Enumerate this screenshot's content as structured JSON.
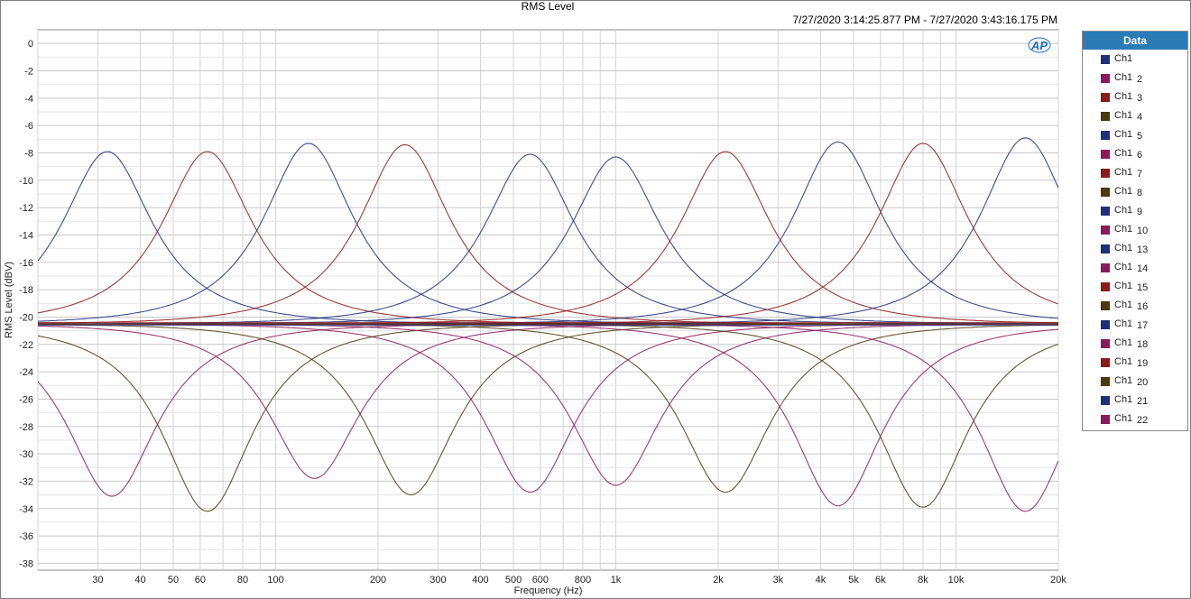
{
  "title": "RMS Level",
  "timestamp": "7/27/2020 3:14:25.877 PM - 7/27/2020 3:43:16.175 PM",
  "logo_text": "AP",
  "legend": {
    "header": "Data",
    "items": [
      {
        "name": "Ch1",
        "num": "",
        "color": "#1f2f7a"
      },
      {
        "name": "Ch1",
        "num": "2",
        "color": "#8b1a5a"
      },
      {
        "name": "Ch1",
        "num": "3",
        "color": "#8b1a1a"
      },
      {
        "name": "Ch1",
        "num": "4",
        "color": "#4a3a10"
      },
      {
        "name": "Ch1",
        "num": "5",
        "color": "#1f2f7a"
      },
      {
        "name": "Ch1",
        "num": "6",
        "color": "#8b1a5a"
      },
      {
        "name": "Ch1",
        "num": "7",
        "color": "#8b1a1a"
      },
      {
        "name": "Ch1",
        "num": "8",
        "color": "#4a3a10"
      },
      {
        "name": "Ch1",
        "num": "9",
        "color": "#1f2f7a"
      },
      {
        "name": "Ch1",
        "num": "10",
        "color": "#8b1a5a"
      },
      {
        "name": "Ch1",
        "num": "13",
        "color": "#1f2f7a"
      },
      {
        "name": "Ch1",
        "num": "14",
        "color": "#8b1a5a"
      },
      {
        "name": "Ch1",
        "num": "15",
        "color": "#8b1a1a"
      },
      {
        "name": "Ch1",
        "num": "16",
        "color": "#4a3a10"
      },
      {
        "name": "Ch1",
        "num": "17",
        "color": "#1f2f7a"
      },
      {
        "name": "Ch1",
        "num": "18",
        "color": "#8b1a5a"
      },
      {
        "name": "Ch1",
        "num": "19",
        "color": "#8b1a1a"
      },
      {
        "name": "Ch1",
        "num": "20",
        "color": "#4a3a10"
      },
      {
        "name": "Ch1",
        "num": "21",
        "color": "#1f2f7a"
      },
      {
        "name": "Ch1",
        "num": "22",
        "color": "#8b1a5a"
      }
    ]
  },
  "chart_data": {
    "type": "line",
    "title": "RMS Level",
    "xlabel": "Frequency (Hz)",
    "ylabel": "RMS Level (dBV)",
    "x_scale": "log",
    "xlim": [
      20,
      20000
    ],
    "ylim": [
      -38.5,
      1
    ],
    "grid": true,
    "legend_position": "right",
    "y_ticks": [
      0,
      -2,
      -4,
      -6,
      -8,
      -10,
      -12,
      -14,
      -16,
      -18,
      -20,
      -22,
      -24,
      -26,
      -28,
      -30,
      -32,
      -34,
      -36,
      -38
    ],
    "x_ticks": [
      {
        "v": 30,
        "label": "30"
      },
      {
        "v": 40,
        "label": "40"
      },
      {
        "v": 50,
        "label": "50"
      },
      {
        "v": 60,
        "label": "60"
      },
      {
        "v": 80,
        "label": "80"
      },
      {
        "v": 100,
        "label": "100"
      },
      {
        "v": 200,
        "label": "200"
      },
      {
        "v": 300,
        "label": "300"
      },
      {
        "v": 400,
        "label": "400"
      },
      {
        "v": 500,
        "label": "500"
      },
      {
        "v": 600,
        "label": "600"
      },
      {
        "v": 800,
        "label": "800"
      },
      {
        "v": 1000,
        "label": "1k"
      },
      {
        "v": 2000,
        "label": "2k"
      },
      {
        "v": 3000,
        "label": "3k"
      },
      {
        "v": 4000,
        "label": "4k"
      },
      {
        "v": 5000,
        "label": "5k"
      },
      {
        "v": 6000,
        "label": "6k"
      },
      {
        "v": 8000,
        "label": "8k"
      },
      {
        "v": 10000,
        "label": "10k"
      },
      {
        "v": 20000,
        "label": "20k"
      }
    ],
    "baseline_db": -20.5,
    "series": [
      {
        "center_hz": 32,
        "peak_db": -7.9,
        "color": "#1f2f7a"
      },
      {
        "center_hz": 63,
        "peak_db": -7.9,
        "color": "#8b1a1a"
      },
      {
        "center_hz": 125,
        "peak_db": -7.3,
        "color": "#1f2f7a"
      },
      {
        "center_hz": 240,
        "peak_db": -7.4,
        "color": "#8b1a1a"
      },
      {
        "center_hz": 560,
        "peak_db": -8.1,
        "color": "#1f2f7a"
      },
      {
        "center_hz": 1000,
        "peak_db": -8.3,
        "color": "#1f2f7a"
      },
      {
        "center_hz": 2100,
        "peak_db": -7.9,
        "color": "#8b1a1a"
      },
      {
        "center_hz": 4500,
        "peak_db": -7.2,
        "color": "#1f2f7a"
      },
      {
        "center_hz": 8000,
        "peak_db": -7.3,
        "color": "#8b1a1a"
      },
      {
        "center_hz": 16000,
        "peak_db": -6.9,
        "color": "#1f2f7a"
      },
      {
        "center_hz": 33,
        "peak_db": -33.1,
        "color": "#8b1a5a"
      },
      {
        "center_hz": 63,
        "peak_db": -34.2,
        "color": "#4a3a10"
      },
      {
        "center_hz": 130,
        "peak_db": -31.8,
        "color": "#8b1a5a"
      },
      {
        "center_hz": 250,
        "peak_db": -33.0,
        "color": "#4a3a10"
      },
      {
        "center_hz": 560,
        "peak_db": -32.8,
        "color": "#8b1a5a"
      },
      {
        "center_hz": 1000,
        "peak_db": -32.3,
        "color": "#8b1a5a"
      },
      {
        "center_hz": 2100,
        "peak_db": -32.8,
        "color": "#4a3a10"
      },
      {
        "center_hz": 4500,
        "peak_db": -33.8,
        "color": "#8b1a5a"
      },
      {
        "center_hz": 8000,
        "peak_db": -33.9,
        "color": "#4a3a10"
      },
      {
        "center_hz": 16000,
        "peak_db": -34.2,
        "color": "#8b1a5a"
      }
    ]
  }
}
